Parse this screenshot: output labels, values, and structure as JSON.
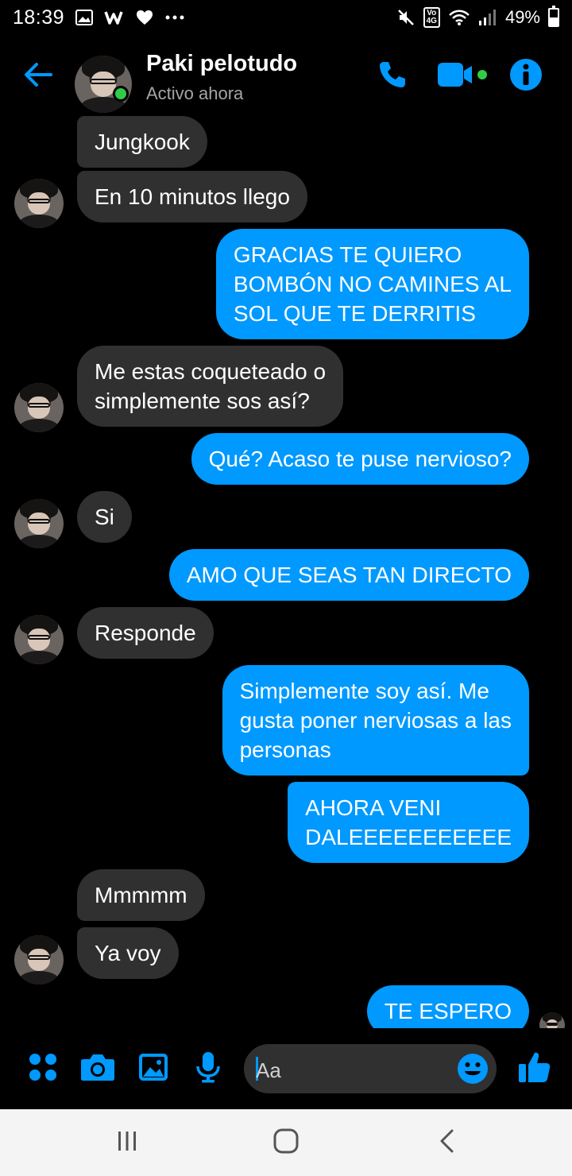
{
  "status_bar": {
    "time": "18:39",
    "battery": "49%",
    "battery_level": 0.49,
    "network_badge": "Vo\n4G",
    "left_icons": [
      "gallery-icon",
      "w-app-icon",
      "heart-icon",
      "more-dots-icon"
    ],
    "right_icons": [
      "mute-icon",
      "volte-4g-icon",
      "wifi-icon",
      "signal-icon",
      "battery-icon"
    ]
  },
  "header": {
    "contact_name": "Paki pelotudo",
    "status": "Activo ahora",
    "accent_color": "#0099ff",
    "online_color": "#31cc46"
  },
  "messages": [
    {
      "side": "in",
      "text": "Jungkook"
    },
    {
      "side": "in",
      "text": "En 10 minutos llego"
    },
    {
      "side": "out",
      "text": "GRACIAS TE QUIERO\nBOMBÓN NO CAMINES AL\nSOL QUE TE DERRITIS"
    },
    {
      "side": "in",
      "text": "Me estas coqueteado o\nsimplemente sos así?"
    },
    {
      "side": "out",
      "text": "Qué? Acaso te puse nervioso?"
    },
    {
      "side": "in",
      "text": "Si"
    },
    {
      "side": "out",
      "text": "AMO QUE SEAS TAN DIRECTO"
    },
    {
      "side": "in",
      "text": "Responde"
    },
    {
      "side": "out",
      "text": "Simplemente soy así. Me\ngusta poner nerviosas a las\npersonas"
    },
    {
      "side": "out",
      "text": "AHORA VENI\nDALEEEEEEEEEEE"
    },
    {
      "side": "in",
      "text": "Mmmmm"
    },
    {
      "side": "in",
      "text": "Ya voy"
    },
    {
      "side": "out",
      "text": "TE ESPERO"
    }
  ],
  "composer": {
    "placeholder": "Aa",
    "icons": [
      "apps-icon",
      "camera-icon",
      "image-icon",
      "microphone-icon",
      "emoji-icon",
      "thumbs-up-icon"
    ]
  },
  "colors": {
    "incoming_bubble": "#303030",
    "outgoing_bubble": "#0099ff",
    "background": "#000000"
  }
}
